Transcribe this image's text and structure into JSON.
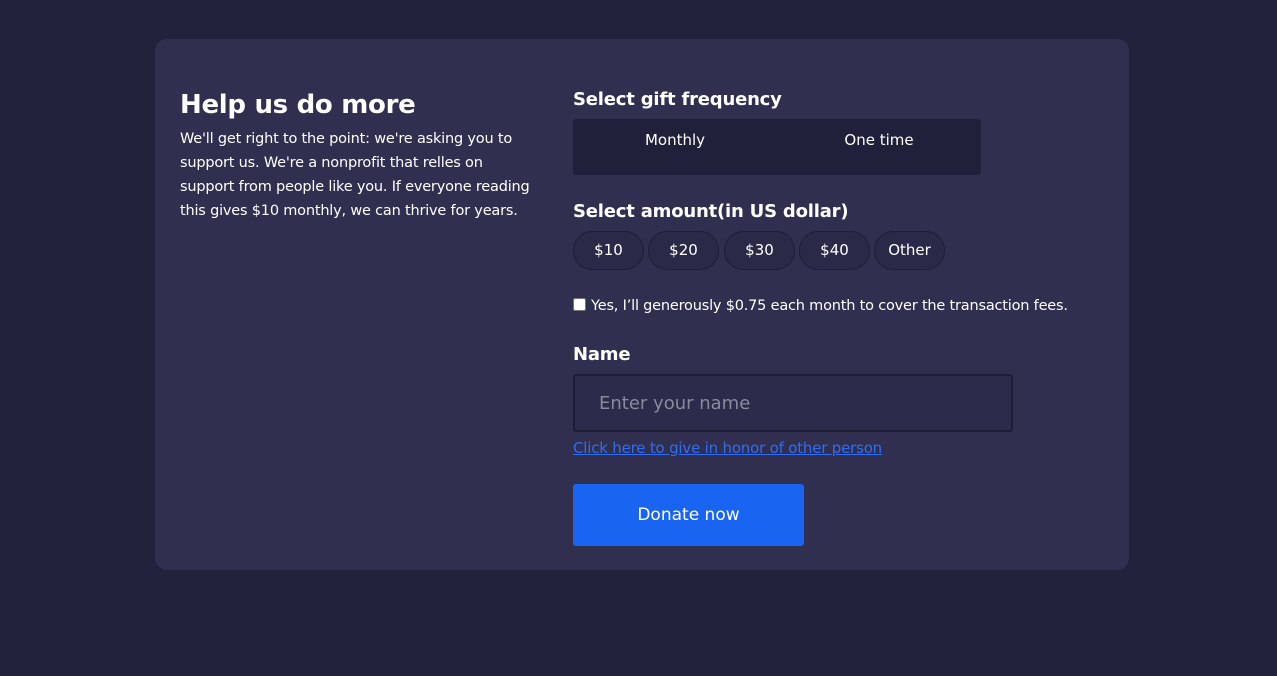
{
  "intro": {
    "title": "Help us do more",
    "body": "We'll get right to the point: we're asking you to support us. We're a nonprofit that relles on support from people like you. If everyone reading this gives $10 monthly, we can thrive for years."
  },
  "frequency": {
    "title": "Select gift frequency",
    "options": [
      "Monthly",
      "One time"
    ]
  },
  "amount": {
    "title": "Select amount(in US dollar)",
    "options": [
      "$10",
      "$20",
      "$30",
      "$40",
      "Other"
    ]
  },
  "fee": {
    "checked": false,
    "label": "Yes, I’ll generously $0.75 each month to cover the transaction fees."
  },
  "name": {
    "title": "Name",
    "value": "",
    "placeholder": "Enter your name"
  },
  "honor_link": "Click here to give in honor of other person",
  "donate_label": "Donate now",
  "colors": {
    "page_background": "#22223d",
    "card_background": "#302f50",
    "accent": "#1a64f2",
    "link": "#2f6df3"
  }
}
